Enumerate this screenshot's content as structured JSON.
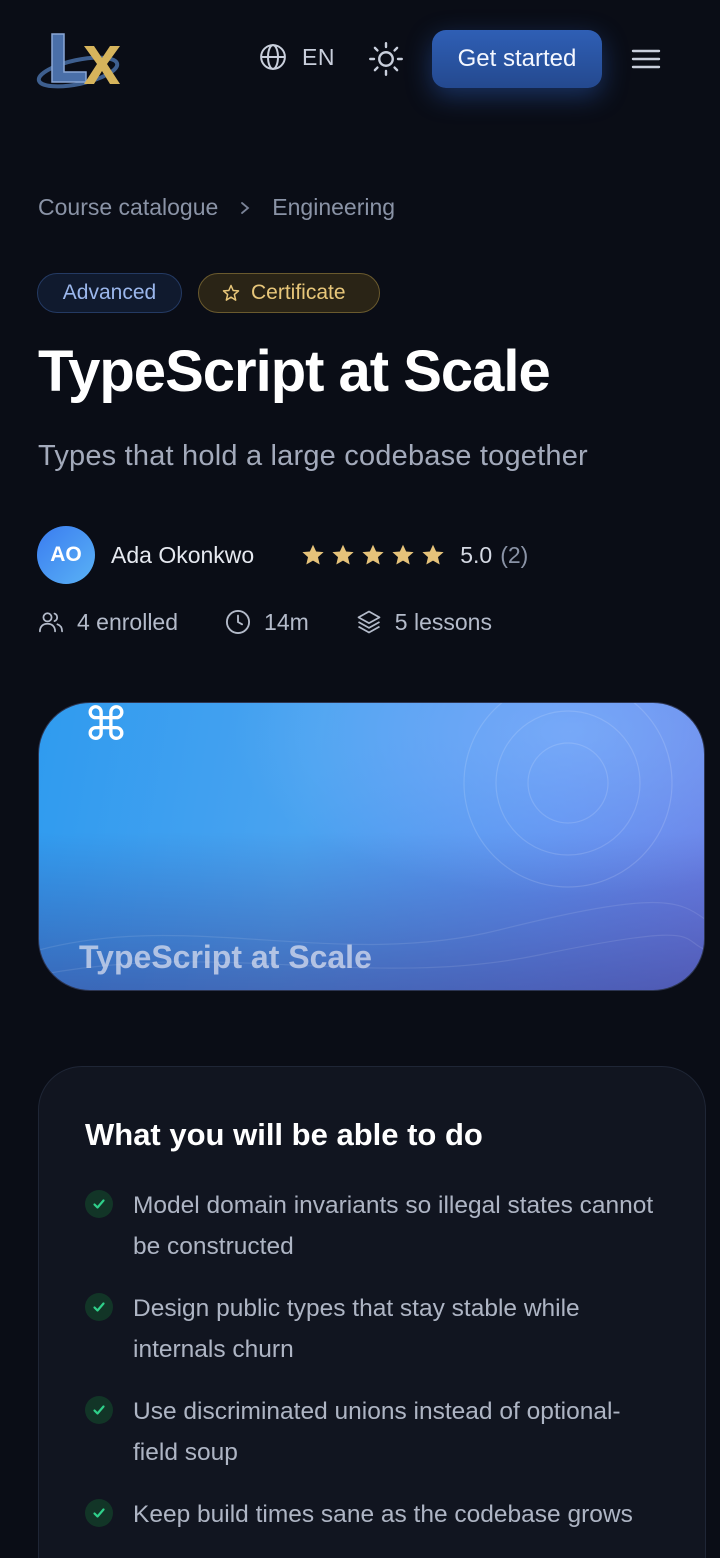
{
  "header": {
    "language_code": "EN",
    "cta_label": "Get started"
  },
  "breadcrumb": {
    "items": [
      "Course catalogue",
      "Engineering"
    ]
  },
  "badges": {
    "level": "Advanced",
    "certificate": "Certificate"
  },
  "course": {
    "title": "TypeScript at Scale",
    "subtitle": "Types that hold a large codebase together"
  },
  "author": {
    "initials": "AO",
    "name": "Ada Okonkwo"
  },
  "rating": {
    "value": "5.0",
    "count": "(2)",
    "stars": 5
  },
  "meta": {
    "enrolled": "4 enrolled",
    "duration": "14m",
    "lessons": "5 lessons"
  },
  "hero": {
    "glyph": "⌘",
    "title": "TypeScript at Scale"
  },
  "outcomes": {
    "heading": "What you will be able to do",
    "items": [
      "Model domain invariants so illegal states cannot be constructed",
      "Design public types that stay stable while internals churn",
      "Use discriminated unions instead of optional-field soup",
      "Keep build times sane as the codebase grows"
    ]
  },
  "colors": {
    "background": "#0a0d16",
    "accent": "#2f5fb5",
    "star": "#e5c27a",
    "check": "#2fd08a"
  }
}
